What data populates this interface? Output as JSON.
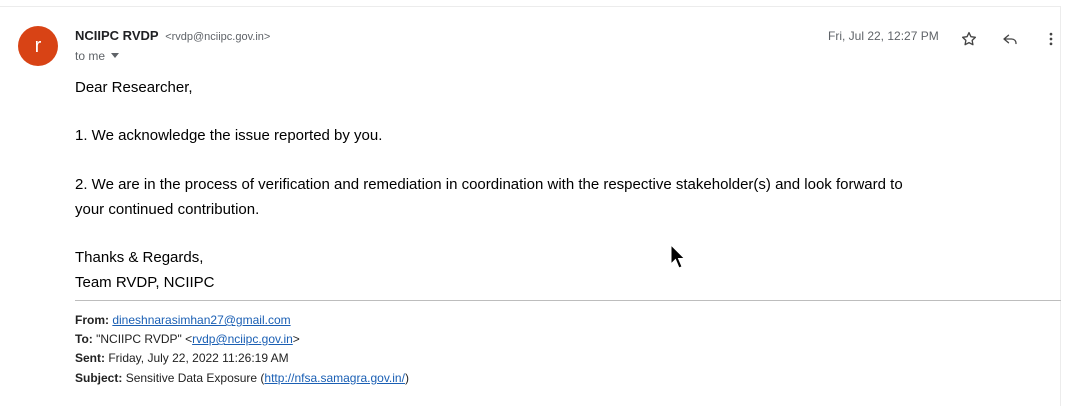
{
  "header": {
    "avatar_letter": "r",
    "sender_name": "NCIIPC RVDP",
    "sender_email": "<rvdp@nciipc.gov.in>",
    "recipient": "to me",
    "date": "Fri, Jul 22, 12:27 PM",
    "icons": [
      "star-icon",
      "reply-icon",
      "more-vert-icon"
    ]
  },
  "body": {
    "greeting": "Dear Researcher,",
    "point1": "1. We acknowledge the issue reported by you.",
    "point2_line1": "2. We are in the process of verification and remediation in coordination with the respective stakeholder(s) and look forward to",
    "point2_line2": "your continued contribution.",
    "closing": "Thanks & Regards,",
    "signature": "Team RVDP, NCIIPC"
  },
  "quoted": {
    "from_label": "From:",
    "from_value": "dineshnarasimhan27@gmail.com",
    "to_label": "To:",
    "to_prefix": "\"NCIIPC RVDP\" <",
    "to_email": "rvdp@nciipc.gov.in",
    "to_suffix": ">",
    "sent_label": "Sent:",
    "sent_value": "Friday, July 22, 2022 11:26:19 AM",
    "subject_label": "Subject:",
    "subject_prefix": "Sensitive Data Exposure (",
    "subject_link": "http://nfsa.samagra.gov.in/",
    "subject_suffix": ")"
  },
  "colors": {
    "avatar_bg": "#d84315",
    "link": "#1a5fb4"
  }
}
